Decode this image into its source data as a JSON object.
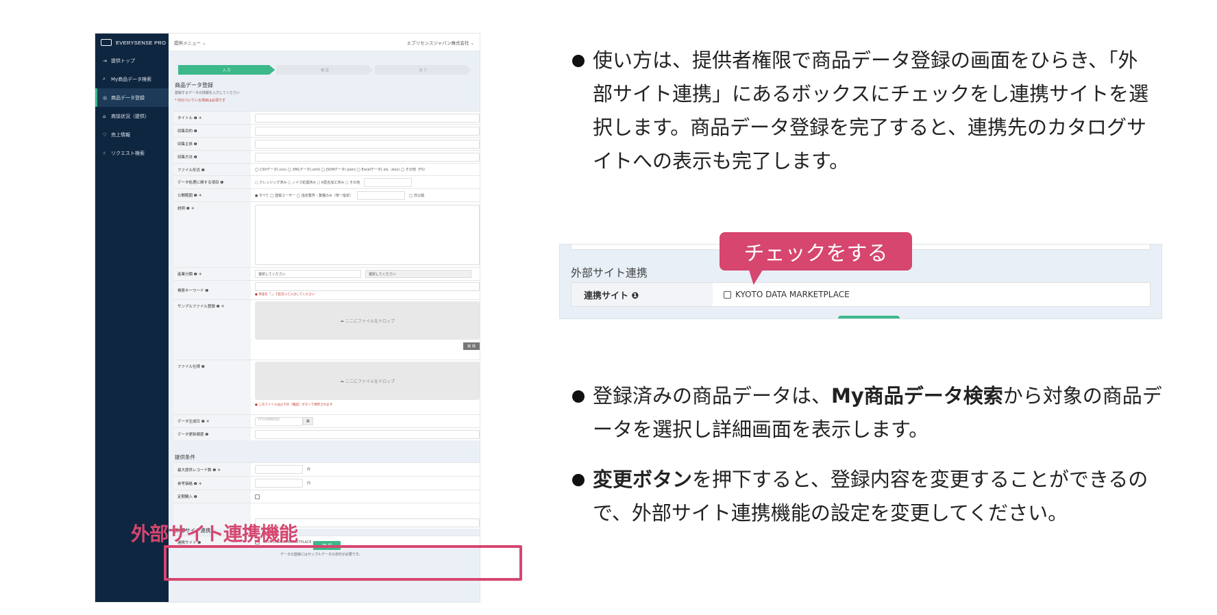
{
  "app": {
    "logo": "EVERYSENSE PRO",
    "menu": "提供メニュー ⌄",
    "company": "エブリセンスジャパン株式会社 ⌄",
    "sidebar": {
      "items": [
        {
          "icon": "login-icon",
          "glyph": "⇥",
          "label": "提供トップ"
        },
        {
          "icon": "search-icon",
          "glyph": "⌕",
          "label": "My商品データ検索"
        },
        {
          "icon": "data-icon",
          "glyph": "◎",
          "label": "商品データ登録",
          "active": true
        },
        {
          "icon": "cart-icon",
          "glyph": "⌂",
          "label": "商談状況（提供）"
        },
        {
          "icon": "sales-icon",
          "glyph": "♡",
          "label": "売上情報"
        },
        {
          "icon": "request-icon",
          "glyph": "☝",
          "label": "リクエスト検索"
        }
      ]
    },
    "steps": [
      "入 力",
      "確 認",
      "完 了"
    ],
    "page_title": "商品データ登録",
    "page_subtitle": "登録するデータの情報を入力してください",
    "required_note": "* 印のついている項目は必須です",
    "form": {
      "title": "タイトル ❶ ＊",
      "purpose": "収集目的 ❶",
      "subject": "収集主体 ❶",
      "method": "収集方法 ❶",
      "format": "ファイル形式 ❶",
      "format_opts": "◯ CSVデータ(.csv)  ◯ XMLデータ(.xml)  ◯ JSONデータ(.json)  ◯ Excelデータ(.xls, .xlsx)  ◯ その他（FX）",
      "processing": "データ処理に関する項目 ❶",
      "processing_opts": "▢ クレンジング済み  ▢ ノイズ処理済み  ▢ K匿名加工済み  ▢ その他",
      "scope": "公開範囲 ❶ ＊",
      "scope_opts": "● すべて  ◯ 登録ユーザー  ◯ 指定業界・業種のみ（単一指定）",
      "scope_private": "◯ 非公開",
      "description": "説明 ❶ ＊",
      "industry": "産業分類 ❶ ＊",
      "select_placeholder": "選択してください",
      "keyword": "検索キーワード ❶",
      "keyword_note": "● 単語を「,」で区切って入力してください",
      "sample": "サンプルファイル登録 ❶ ＊",
      "drop_text": "ここにファイルをドロップ",
      "delete_btn": "削 除",
      "spec": "ファイル仕様 ❶",
      "spec_note": "● このファイルは以下の［確認］ボタンで保存されます",
      "date_gen": "データ生成日 ❶ ＊",
      "date_placeholder": "YYYY/MM/DD",
      "date_upd": "データ更新頻度 ❶"
    },
    "offer_section": "提供条件",
    "offer": {
      "max_records": "最大提供レコード数 ❶ ＊",
      "unit_records": "件",
      "price": "参考価格 ❶ ＊",
      "unit_price": "円",
      "subscription": "定期購入 ❶"
    },
    "ext_section": "外部サイト連携",
    "ext_label": "連携サイト ❶",
    "ext_site": "KYOTO DATA MARKETPLACE",
    "confirm_btn": "確 認",
    "footer_note": "データの登録にはサンプルデータの添付が必要です。"
  },
  "annotation_tag": "外部サイト連携機能",
  "callout": "チェックをする",
  "zoom": {
    "section": "外部サイト連携",
    "label": "連携サイト ❶",
    "site": "KYOTO DATA MARKETPLACE"
  },
  "bullets": {
    "b1": "使い方は、提供者権限で商品データ登録の画面をひらき、「外部サイト連携」にあるボックスにチェックをし連携サイトを選択します。商品データ登録を完了すると、連携先のカタログサイトへの表示も完了します。",
    "b2_pre": "登録済みの商品データは、",
    "b2_bold": "My商品データ検索",
    "b2_post": "から対象の商品データを選択し詳細画面を表示します。",
    "b3_bold": "変更ボタン",
    "b3_post": "を押下すると、登録内容を変更することができるので、外部サイト連携機能の設定を変更してください。"
  },
  "colors": {
    "accent": "#d6466f",
    "sidebar": "#0f2640",
    "green": "#3cb88a"
  }
}
